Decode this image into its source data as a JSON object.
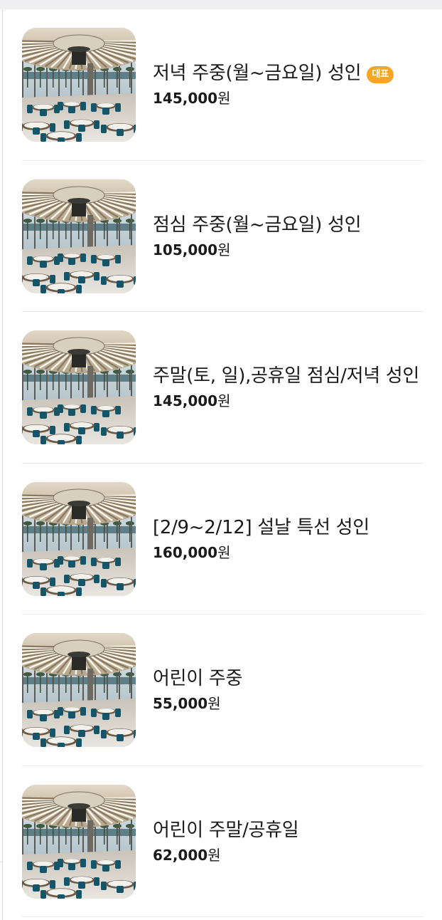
{
  "menu": {
    "items": [
      {
        "name": "저녁 주중(월~금요일) 성인",
        "badge": "대표",
        "price": "145,000",
        "currency": "원",
        "image": "restaurant-dining-room-image"
      },
      {
        "name": "점심 주중(월~금요일) 성인",
        "badge": "",
        "price": "105,000",
        "currency": "원",
        "image": "restaurant-dining-room-image"
      },
      {
        "name": "주말(토, 일),공휴일 점심/저녁 성인",
        "badge": "",
        "price": "145,000",
        "currency": "원",
        "image": "restaurant-dining-room-image"
      },
      {
        "name": "[2/9~2/12] 설날 특선 성인",
        "badge": "",
        "price": "160,000",
        "currency": "원",
        "image": "restaurant-dining-room-image"
      },
      {
        "name": "어린이 주중",
        "badge": "",
        "price": "55,000",
        "currency": "원",
        "image": "restaurant-dining-room-image"
      },
      {
        "name": "어린이 주말/공휴일",
        "badge": "",
        "price": "62,000",
        "currency": "원",
        "image": "restaurant-dining-room-image"
      }
    ]
  },
  "colors": {
    "badge": "#f5a623",
    "text": "#1a1a1a",
    "divider": "#ebebed",
    "chair": "#14556a"
  }
}
